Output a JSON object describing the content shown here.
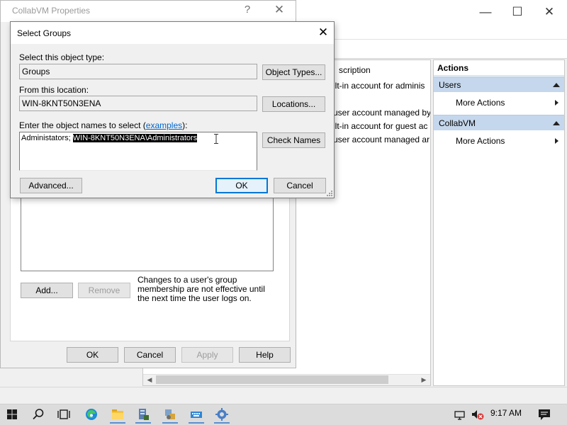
{
  "mmc": {
    "list": {
      "header_description": "scription",
      "rows": [
        "ilt-in account for adminis",
        "user account managed by",
        "ilt-in account for guest ac",
        "user account managed ar"
      ]
    },
    "actions": {
      "title": "Actions",
      "groups": [
        {
          "label": "Users",
          "item": "More Actions"
        },
        {
          "label": "CollabVM",
          "item": "More Actions"
        }
      ]
    }
  },
  "properties": {
    "title": "CollabVM Properties",
    "help_glyph": "?",
    "add_label": "Add...",
    "remove_label": "Remove",
    "note": "Changes to a user's group membership are not effective until the next time the user logs on.",
    "ok_label": "OK",
    "cancel_label": "Cancel",
    "apply_label": "Apply",
    "help_label": "Help"
  },
  "dialog": {
    "title": "Select Groups",
    "object_type_label": "Select this object type:",
    "object_type_value": "Groups",
    "object_types_button": "Object Types...",
    "location_label": "From this location:",
    "location_value": "WIN-8KNT50N3ENA",
    "locations_button": "Locations...",
    "names_label_prefix": "Enter the object names to select (",
    "names_label_link": "examples",
    "names_label_suffix": "):",
    "names_plain": "Administators; ",
    "names_selected": "WIN-8KNT50N3ENA\\Administrators",
    "check_names_button": "Check Names",
    "advanced_button": "Advanced...",
    "ok_button": "OK",
    "cancel_button": "Cancel"
  },
  "taskbar": {
    "time": "9:17 AM"
  },
  "colors": {
    "accent": "#0078d7",
    "selection": "#000000",
    "actions_group": "#c5d7ec"
  }
}
